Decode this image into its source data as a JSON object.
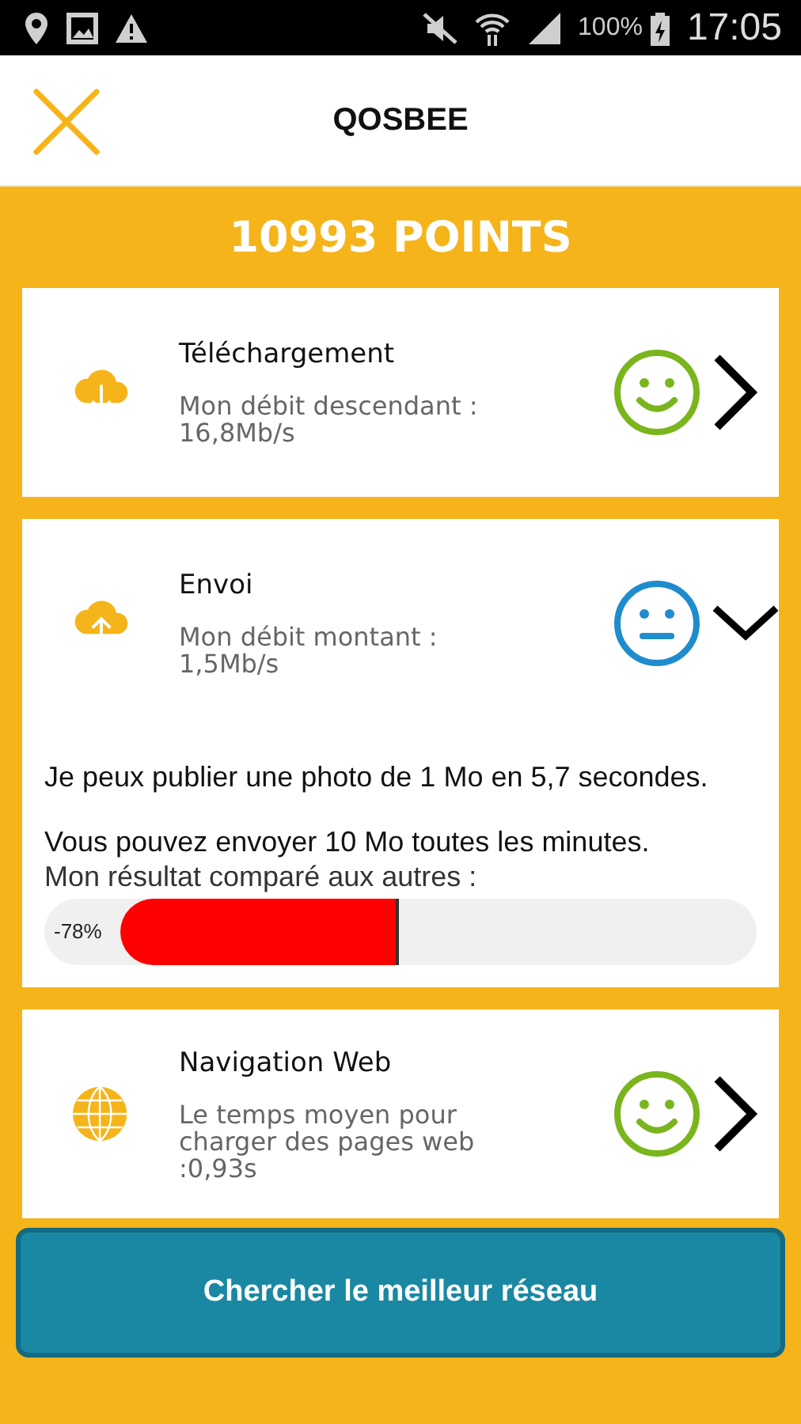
{
  "status_bar": {
    "battery": "100%",
    "time": "17:05"
  },
  "header": {
    "title": "QOSBEE"
  },
  "points": "10993 POINTS",
  "tests": [
    {
      "kind": "download",
      "title": "Téléchargement",
      "detail": "Mon débit descendant : 16,8Mb/s",
      "happy": true,
      "expanded": false
    },
    {
      "kind": "upload",
      "title": "Envoi",
      "detail": "Mon débit montant : 1,5Mb/s",
      "happy": false,
      "expanded": true,
      "body": [
        "Je peux publier une photo de 1 Mo en 5,7 secondes.",
        "Vous pouvez envoyer 10 Mo toutes les minutes."
      ],
      "comparison_label": "Mon résultat comparé aux autres :",
      "comparison": {
        "reading": "-78%"
      }
    },
    {
      "kind": "web",
      "title": "Navigation Web",
      "detail": "Le temps moyen pour charger des pages web :0,93s",
      "happy": true,
      "expanded": false
    }
  ],
  "action_button": "Chercher le meilleur réseau"
}
